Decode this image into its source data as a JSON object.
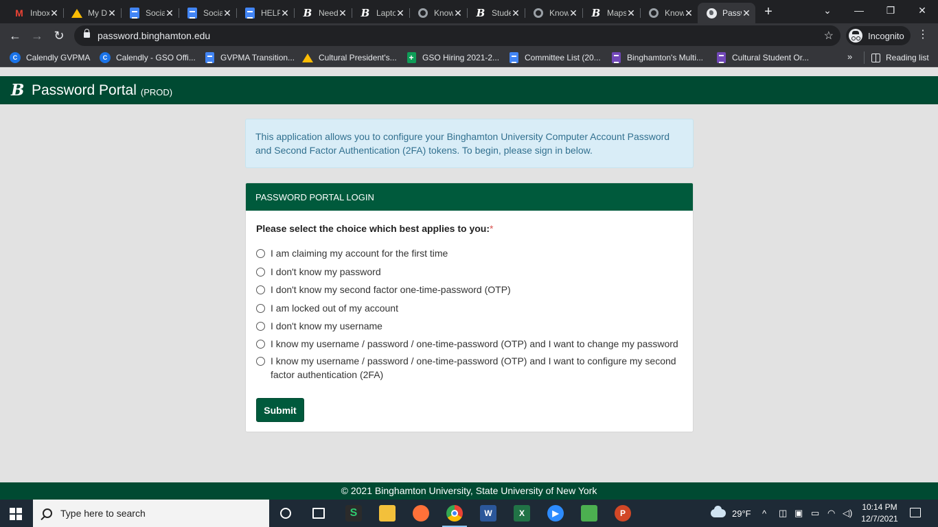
{
  "browser": {
    "tabs": [
      {
        "title": "Inbox",
        "icon": "gmail-icon",
        "active": false
      },
      {
        "title": "My Drive",
        "icon": "drive-icon",
        "active": false
      },
      {
        "title": "Social",
        "icon": "docs-icon",
        "active": false
      },
      {
        "title": "Social",
        "icon": "docs-icon",
        "active": false
      },
      {
        "title": "HELP",
        "icon": "docs-icon",
        "active": false
      },
      {
        "title": "Need",
        "icon": "binghamton-icon",
        "active": false
      },
      {
        "title": "Laptop",
        "icon": "binghamton-icon",
        "active": false
      },
      {
        "title": "Knowledge",
        "icon": "ring-icon",
        "active": false
      },
      {
        "title": "Student",
        "icon": "binghamton-icon",
        "active": false
      },
      {
        "title": "Knowledge",
        "icon": "ring-icon",
        "active": false
      },
      {
        "title": "Maps",
        "icon": "binghamton-icon",
        "active": false
      },
      {
        "title": "Knowledge",
        "icon": "ring-icon",
        "active": false
      },
      {
        "title": "Password Portal",
        "icon": "globe-icon",
        "active": true
      }
    ],
    "url": "password.binghamton.edu",
    "profile_label": "Incognito",
    "bookmarks": [
      {
        "label": "Calendly GVPMA",
        "icon": "calendly-icon"
      },
      {
        "label": "Calendly - GSO Offi...",
        "icon": "calendly-icon"
      },
      {
        "label": "GVPMA Transition...",
        "icon": "docs-icon"
      },
      {
        "label": "Cultural President's...",
        "icon": "drive-icon"
      },
      {
        "label": "GSO Hiring 2021-2...",
        "icon": "sheets-icon"
      },
      {
        "label": "Committee List (20...",
        "icon": "docs-icon"
      },
      {
        "label": "Binghamton's Multi...",
        "icon": "forms-icon"
      },
      {
        "label": "Cultural Student Or...",
        "icon": "forms-icon"
      }
    ],
    "bookmarks_more": "»",
    "reading_list_label": "Reading list"
  },
  "page": {
    "logo_letter": "B",
    "title": "Password Portal",
    "environment": "(PROD)",
    "info_text": "This application allows you to configure your Binghamton University Computer Account Password and Second Factor Authentication (2FA) tokens. To begin, please sign in below.",
    "panel_title": "PASSWORD PORTAL LOGIN",
    "question": "Please select the choice which best applies to you:",
    "required_mark": "*",
    "options": [
      "I am claiming my account for the first time",
      "I don't know my password",
      "I don't know my second factor one-time-password (OTP)",
      "I am locked out of my account",
      "I don't know my username",
      "I know my username / password / one-time-password (OTP) and I want to change my password",
      "I know my username / password / one-time-password (OTP) and I want to configure my second factor authentication (2FA)"
    ],
    "submit_label": "Submit",
    "footer": "© 2021 Binghamton University, State University of New York"
  },
  "taskbar": {
    "search_placeholder": "Type here to search",
    "weather": "29°F",
    "time": "10:14 PM",
    "date": "12/7/2021"
  },
  "colors": {
    "brand_green": "#004a32",
    "panel_green": "#005a3c",
    "info_bg": "#d9edf7",
    "info_text": "#31708f"
  }
}
